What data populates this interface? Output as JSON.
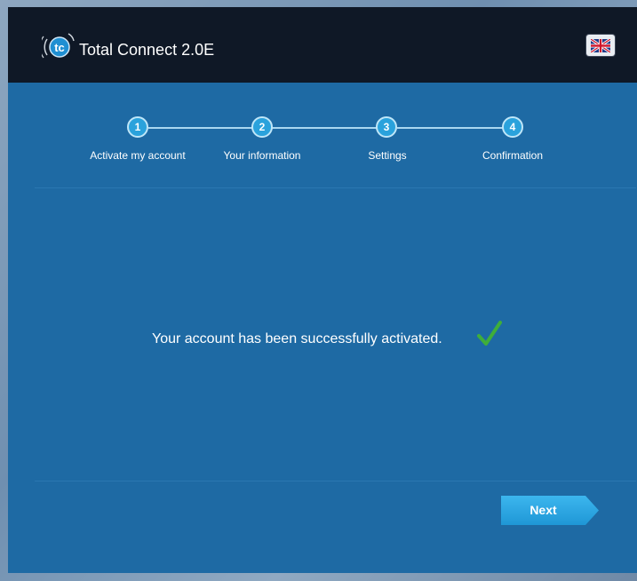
{
  "app": {
    "title": "Total Connect 2.0E",
    "logo_text": "tc",
    "language": "English (UK)"
  },
  "stepper": {
    "steps": [
      {
        "number": "1",
        "label": "Activate my account"
      },
      {
        "number": "2",
        "label": "Your information"
      },
      {
        "number": "3",
        "label": "Settings"
      },
      {
        "number": "4",
        "label": "Confirmation"
      }
    ]
  },
  "main": {
    "message": "Your account has been successfully activated."
  },
  "footer": {
    "next_label": "Next"
  },
  "colors": {
    "header_bg": "#0f1826",
    "panel_bg": "#1e6aa4",
    "accent": "#2aa2dc",
    "success": "#3fae3a"
  }
}
